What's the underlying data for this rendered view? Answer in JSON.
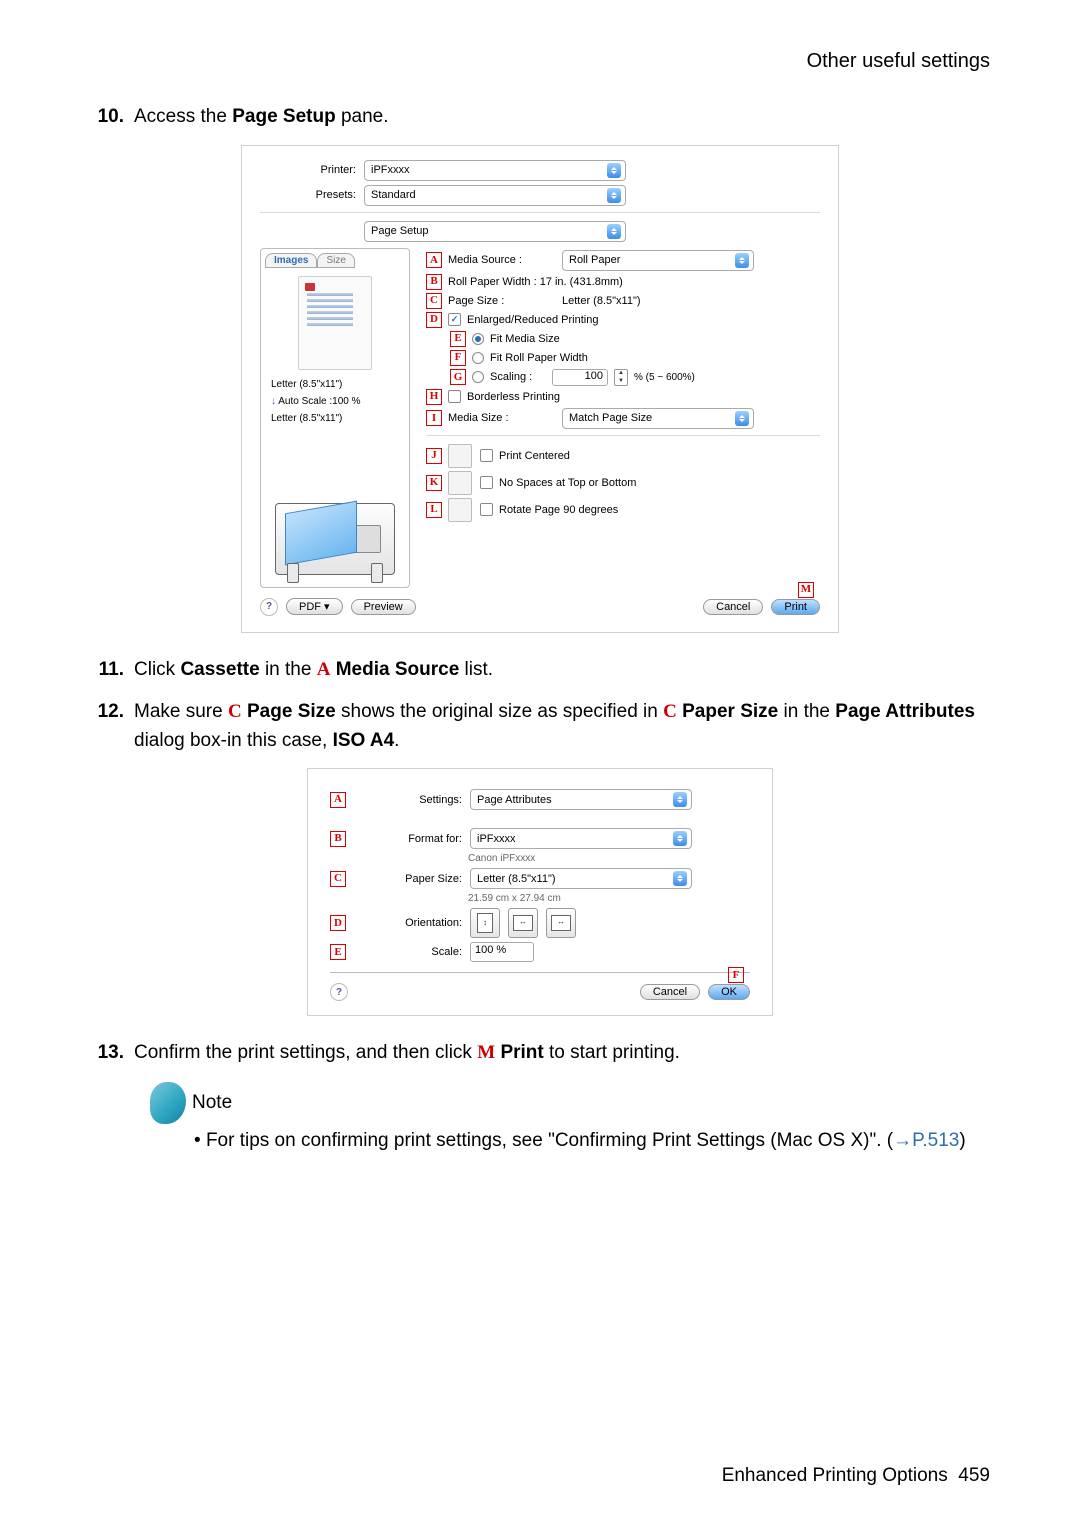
{
  "header": {
    "title": "Other useful settings"
  },
  "steps": {
    "s10": {
      "num": "10.",
      "text_1": "Access the ",
      "bold_1": "Page Setup",
      "text_2": " pane."
    },
    "s11": {
      "num": "11.",
      "text_1": "Click ",
      "bold_1": "Cassette",
      "text_2": " in the ",
      "ref_1": "A",
      "bold_2": "Media Source",
      "text_3": " list."
    },
    "s12": {
      "num": "12.",
      "text_1": "Make sure ",
      "ref_1": "C",
      "bold_1": "Page Size",
      "text_2": " shows the original size as specified in ",
      "ref_2": "C",
      "bold_2": "Paper Size",
      "text_3": " in the ",
      "bold_3": "Page Attributes",
      "text_4": " dialog box-in this case, ",
      "bold_4": "ISO A4",
      "text_5": "."
    },
    "s13": {
      "num": "13.",
      "text_1": "Confirm the print settings, and then click ",
      "ref_1": "M",
      "bold_1": "Print",
      "text_2": " to start printing."
    }
  },
  "note": {
    "label": "Note",
    "bullet_prefix": "• ",
    "text_1": "For tips on confirming print settings, see \"Confirming Print Settings (Mac OS X)\". (",
    "link": "→P.513",
    "text_2": ")"
  },
  "footer": {
    "text": "Enhanced Printing Options",
    "page": "459"
  },
  "shot1": {
    "labels": {
      "printer": "Printer:",
      "presets": "Presets:"
    },
    "printer_val": "iPFxxxx",
    "presets_val": "Standard",
    "pane_val": "Page Setup",
    "tabs": {
      "images": "Images",
      "size": "Size"
    },
    "left_info": {
      "l1": "Letter (8.5\"x11\")",
      "l2_a": "Auto Scale :",
      "l2_b": "100 %",
      "l3": "Letter (8.5\"x11\")"
    },
    "refs": {
      "A": "A",
      "B": "B",
      "C": "C",
      "D": "D",
      "E": "E",
      "F": "F",
      "G": "G",
      "H": "H",
      "I": "I",
      "J": "J",
      "K": "K",
      "L": "L",
      "M": "M"
    },
    "rows": {
      "media_source_lab": "Media Source :",
      "media_source_val": "Roll Paper",
      "roll_width": "Roll Paper Width : 17 in. (431.8mm)",
      "page_size_lab": "Page Size :",
      "page_size_val": "Letter (8.5\"x11\")",
      "enlarge": "Enlarged/Reduced Printing",
      "fit_media": "Fit Media Size",
      "fit_roll": "Fit Roll Paper Width",
      "scaling": "Scaling :",
      "scaling_val": "100",
      "scaling_range": "% (5 ~ 600%)",
      "borderless": "Borderless Printing",
      "media_size_lab": "Media Size :",
      "media_size_val": "Match Page Size",
      "print_centered": "Print Centered",
      "no_spaces": "No Spaces at Top or Bottom",
      "rotate": "Rotate Page 90 degrees"
    },
    "buttons": {
      "pdf": "PDF ▾",
      "preview": "Preview",
      "cancel": "Cancel",
      "print": "Print",
      "help": "?"
    }
  },
  "shot2": {
    "refs": {
      "A": "A",
      "B": "B",
      "C": "C",
      "D": "D",
      "E": "E",
      "F": "F"
    },
    "labels": {
      "settings": "Settings:",
      "format": "Format for:",
      "paper": "Paper Size:",
      "orient": "Orientation:",
      "scale": "Scale:"
    },
    "vals": {
      "settings": "Page Attributes",
      "format": "iPFxxxx",
      "format_sub": "Canon iPFxxxx",
      "paper": "Letter (8.5\"x11\")",
      "paper_sub": "21.59 cm x 27.94 cm",
      "scale": "100 %"
    },
    "buttons": {
      "cancel": "Cancel",
      "ok": "OK",
      "help": "?"
    },
    "ori_glyph": "⬍"
  }
}
